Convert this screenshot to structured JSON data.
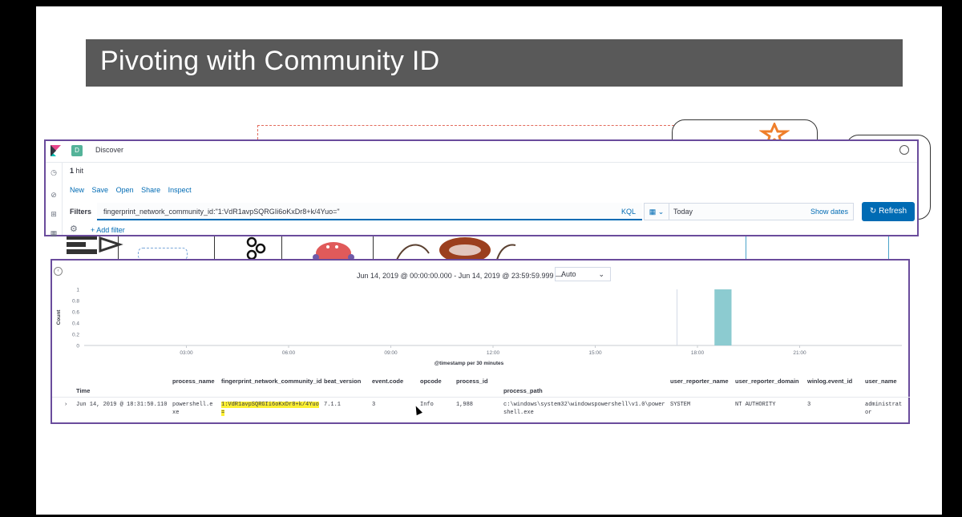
{
  "slide": {
    "title": "Pivoting with Community ID"
  },
  "navbar": {
    "app_badge": "D",
    "breadcrumb": "Discover"
  },
  "hits": {
    "count": "1",
    "label": "hit"
  },
  "topnav": {
    "new": "New",
    "save": "Save",
    "open": "Open",
    "share": "Share",
    "inspect": "Inspect"
  },
  "filters": {
    "label": "Filters",
    "query": "fingerprint_network_community_id:\"1:VdR1avpSQRGIi6oKxDr8+k/4Yuo=\"",
    "language": "KQL",
    "date_value": "Today",
    "show_dates": "Show dates",
    "refresh": "Refresh",
    "add_filter": "+ Add filter"
  },
  "histogram": {
    "time_range": "Jun 14, 2019 @ 00:00:00.000 - Jun 14, 2019 @ 23:59:59.999 —",
    "interval": "Auto",
    "ylabel": "Count",
    "xlabel": "@timestamp per 30 minutes"
  },
  "chart_data": {
    "type": "bar",
    "x_ticks": [
      "03:00",
      "06:00",
      "09:00",
      "12:00",
      "15:00",
      "18:00",
      "21:00"
    ],
    "y_ticks": [
      "1",
      "0.8",
      "0.6",
      "0.4",
      "0.2",
      "0"
    ],
    "ylim": [
      0,
      1
    ],
    "series": [
      {
        "values": [
          {
            "x": "18:30",
            "y": 1
          }
        ]
      }
    ],
    "color": "#8ccbd0",
    "xlabel": "@timestamp per 30 minutes",
    "ylabel": "Count",
    "grid": false
  },
  "table": {
    "columns": [
      "Time",
      "process_name",
      "fingerprint_network_community_id",
      "beat_version",
      "event.code",
      "opcode",
      "process_id",
      "process_path",
      "user_reporter_name",
      "user_reporter_domain",
      "winlog.event_id",
      "user_name"
    ],
    "row": {
      "time": "Jun 14, 2019 @ 18:31:50.110",
      "process_name_1": "powershell.e",
      "process_name_2": "xe",
      "community_id_1": "1:VdR1avpSQRGIi6oKxDr8+k/4Yuo",
      "community_id_2": "=",
      "beat_version": "7.1.1",
      "event_code": "3",
      "opcode": "Info",
      "process_id": "1,988",
      "process_path_1": "c:\\windows\\system32\\windowspowershell\\v1.0\\power",
      "process_path_2": "shell.exe",
      "user_reporter_name": "SYSTEM",
      "user_reporter_domain": "NT AUTHORITY",
      "winlog_event_id": "3",
      "user_name_1": "administrat",
      "user_name_2": "or"
    }
  }
}
